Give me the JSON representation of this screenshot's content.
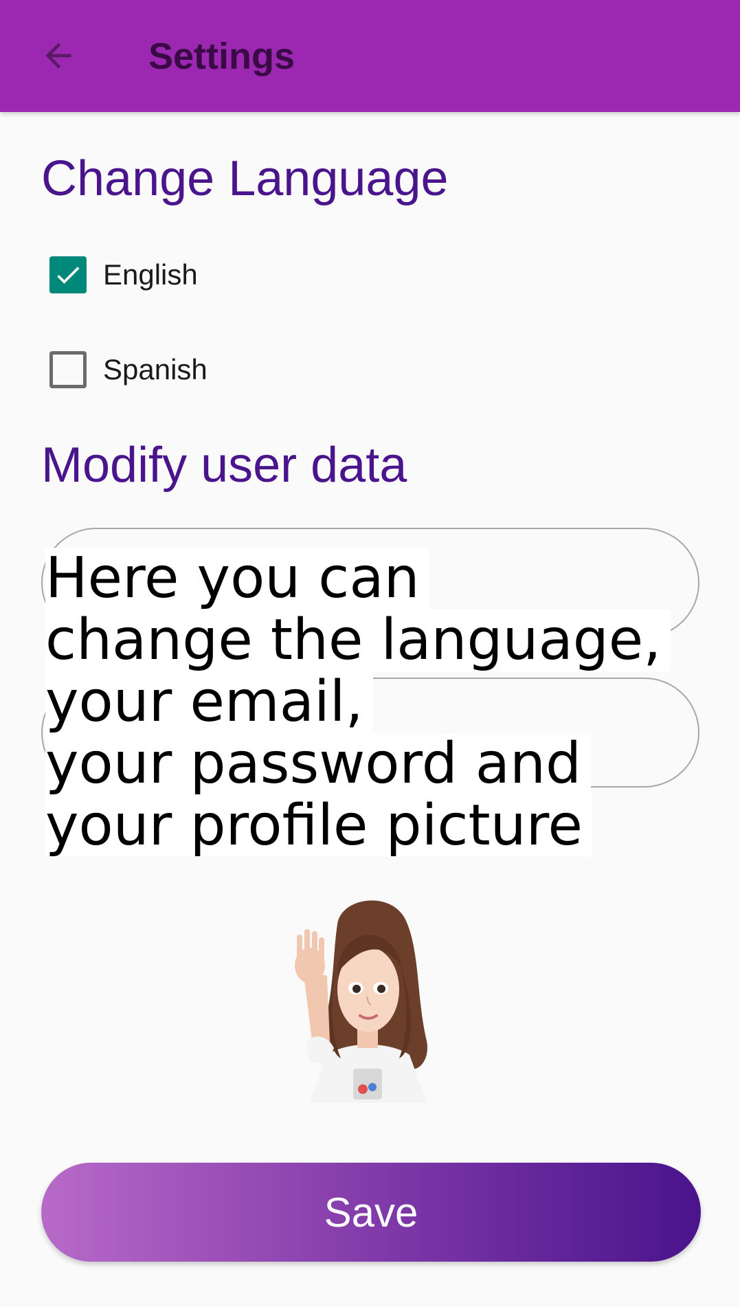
{
  "appbar": {
    "title": "Settings",
    "back_icon": "arrow-left-icon",
    "background": "#9c27b0"
  },
  "language": {
    "title": "Change Language",
    "options": [
      {
        "label": "English",
        "checked": true
      },
      {
        "label": "Spanish",
        "checked": false
      }
    ]
  },
  "user_data": {
    "title": "Modify user data",
    "fields": [
      {
        "value": ""
      },
      {
        "value": ""
      }
    ]
  },
  "overlay": {
    "lines": [
      "Here you can",
      "change the language,",
      "your email,",
      "your password and",
      "your profile picture"
    ]
  },
  "avatar": {
    "icon": "waving-girl-avatar"
  },
  "save_button": {
    "label": "Save"
  },
  "colors": {
    "accent": "#4a148c",
    "checkbox": "#00897b"
  }
}
